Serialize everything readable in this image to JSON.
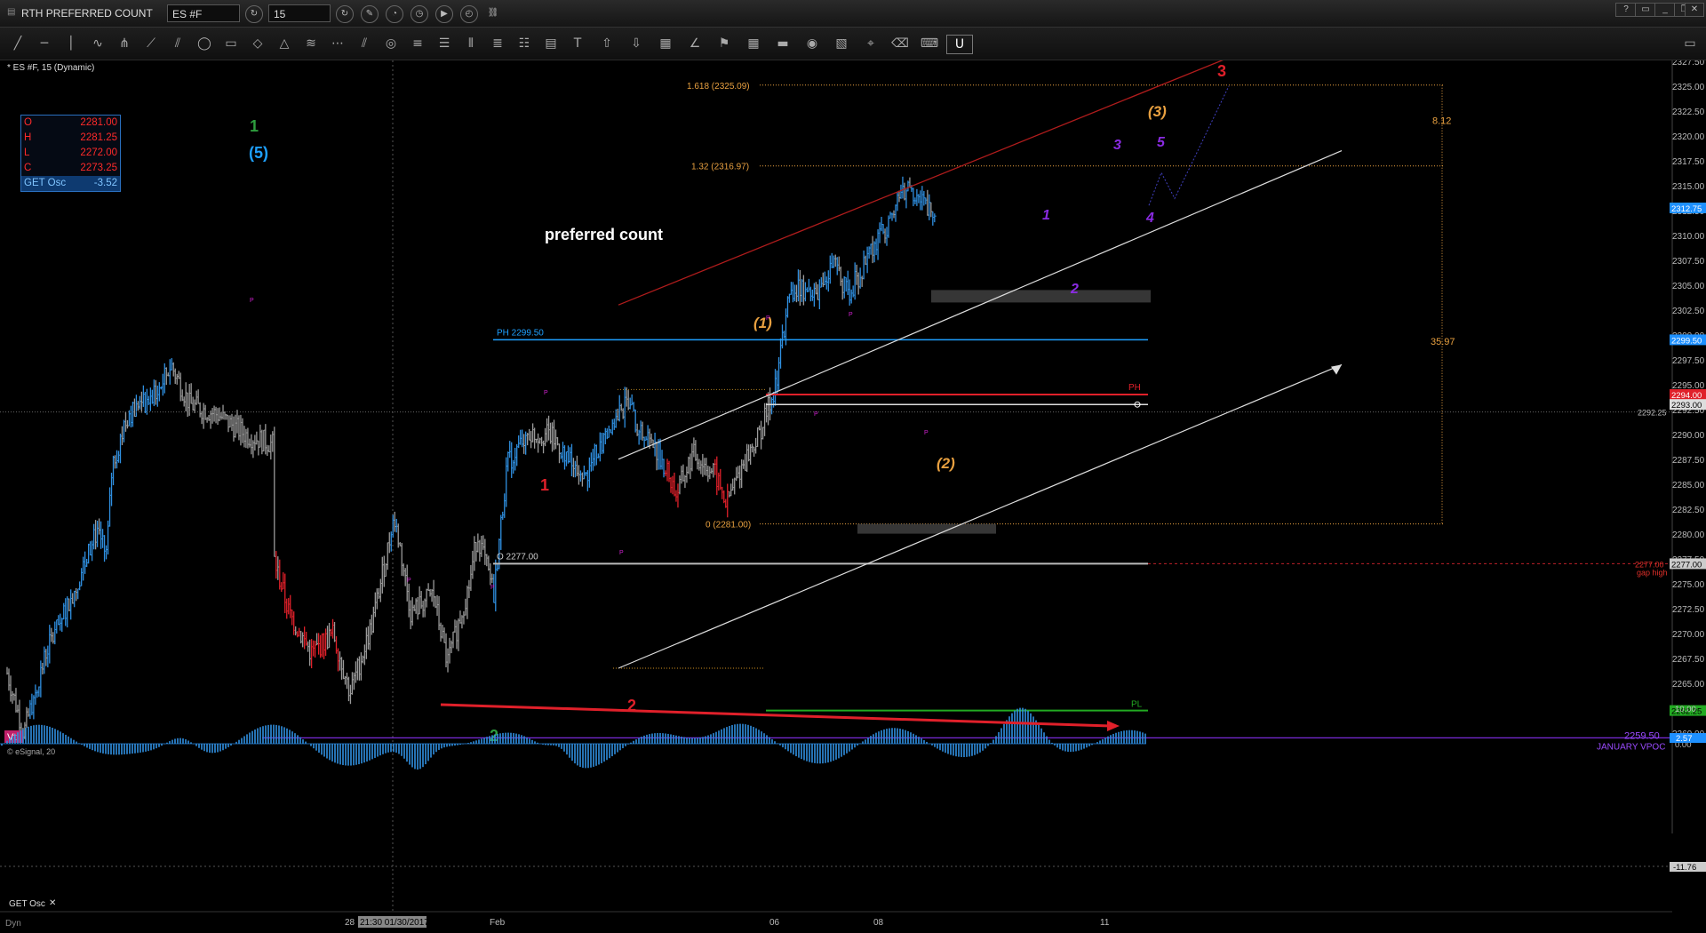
{
  "window": {
    "title": "RTH  PREFERRED COUNT",
    "symbol_value": "ES #F",
    "interval_value": "15"
  },
  "chart_header": "* ES #F, 15 (Dynamic)",
  "ohlc_box": [
    {
      "label": "O",
      "value": "2281.00"
    },
    {
      "label": "H",
      "value": "2281.25"
    },
    {
      "label": "L",
      "value": "2272.00"
    },
    {
      "label": "C",
      "value": "2273.25"
    },
    {
      "label": "GET Osc",
      "value": "-3.52"
    }
  ],
  "colors": {
    "up": "#2f8fe0",
    "down": "#e0202a",
    "neutral": "#9a9a9a",
    "fib": "#e8a040",
    "wave_purple": "#8a2be2"
  },
  "chart_data": {
    "type": "bar",
    "title": "preferred count",
    "subtitle": "* ES #F, 15 (Dynamic)",
    "ylim": [
      2257.5,
      2328.75
    ],
    "y_ticks": [
      "2327.50",
      "2325.00",
      "2322.50",
      "2320.00",
      "2317.50",
      "2315.00",
      "2312.50",
      "2310.00",
      "2307.50",
      "2305.00",
      "2302.50",
      "2300.00",
      "2297.50",
      "2295.00",
      "2292.50",
      "2290.00",
      "2287.50",
      "2285.00",
      "2282.50",
      "2280.00",
      "2277.50",
      "2275.00",
      "2272.50",
      "2270.00",
      "2267.50",
      "2265.00",
      "2262.50",
      "2260.00"
    ],
    "x_ticks": [
      "28",
      "21:30 01/30/2017",
      "Feb",
      "06",
      "08",
      "11"
    ],
    "price_path": [
      {
        "x": 0,
        "y": 2266
      },
      {
        "x": 15,
        "y": 2260
      },
      {
        "x": 35,
        "y": 2268
      },
      {
        "x": 60,
        "y": 2274
      },
      {
        "x": 80,
        "y": 2280
      },
      {
        "x": 90,
        "y": 2278
      },
      {
        "x": 95,
        "y": 2287
      },
      {
        "x": 110,
        "y": 2292
      },
      {
        "x": 135,
        "y": 2294
      },
      {
        "x": 148,
        "y": 2297
      },
      {
        "x": 165,
        "y": 2293
      },
      {
        "x": 190,
        "y": 2292
      },
      {
        "x": 215,
        "y": 2290
      },
      {
        "x": 240,
        "y": 2289
      },
      {
        "x": 240,
        "y": 2278
      },
      {
        "x": 255,
        "y": 2272
      },
      {
        "x": 275,
        "y": 2268
      },
      {
        "x": 295,
        "y": 2270
      },
      {
        "x": 310,
        "y": 2264
      },
      {
        "x": 330,
        "y": 2271
      },
      {
        "x": 345,
        "y": 2279
      },
      {
        "x": 350,
        "y": 2282
      },
      {
        "x": 365,
        "y": 2272
      },
      {
        "x": 385,
        "y": 2274
      },
      {
        "x": 398,
        "y": 2267
      },
      {
        "x": 418,
        "y": 2275
      },
      {
        "x": 425,
        "y": 2280
      },
      {
        "x": 440,
        "y": 2274
      },
      {
        "x": 452,
        "y": 2287
      },
      {
        "x": 470,
        "y": 2290
      },
      {
        "x": 490,
        "y": 2290
      },
      {
        "x": 505,
        "y": 2288
      },
      {
        "x": 520,
        "y": 2285
      },
      {
        "x": 540,
        "y": 2290
      },
      {
        "x": 560,
        "y": 2293
      },
      {
        "x": 575,
        "y": 2290
      },
      {
        "x": 590,
        "y": 2288
      },
      {
        "x": 605,
        "y": 2284
      },
      {
        "x": 620,
        "y": 2288
      },
      {
        "x": 640,
        "y": 2286
      },
      {
        "x": 650,
        "y": 2283
      },
      {
        "x": 665,
        "y": 2287
      },
      {
        "x": 680,
        "y": 2290
      },
      {
        "x": 695,
        "y": 2295
      },
      {
        "x": 705,
        "y": 2303
      },
      {
        "x": 715,
        "y": 2305
      },
      {
        "x": 730,
        "y": 2304
      },
      {
        "x": 748,
        "y": 2307
      },
      {
        "x": 760,
        "y": 2304
      },
      {
        "x": 780,
        "y": 2308
      },
      {
        "x": 800,
        "y": 2312
      },
      {
        "x": 815,
        "y": 2315
      },
      {
        "x": 830,
        "y": 2313
      },
      {
        "x": 840,
        "y": 2312
      }
    ],
    "oscillator": {
      "name": "GET Osc",
      "last": "2.57",
      "levels": [
        "10.00",
        "0.00",
        "-11.76"
      ]
    },
    "price_tags": [
      "2312.75",
      "2299.50",
      "2294.00",
      "2293.00",
      "2277.00",
      "2262.25",
      "2259.50",
      "2292.25",
      "2277.00"
    ],
    "levels": [
      {
        "label": "PH 2299.50",
        "price": 2299.5
      },
      {
        "label": "O 2277.00",
        "price": 2277.0
      },
      {
        "label": "PH",
        "price": 2294.0
      },
      {
        "label": "PL",
        "price": 2262.25
      },
      {
        "label": "2259.50",
        "price": 2259.5
      },
      {
        "label": "JANUARY VPOC",
        "price": 2259.5
      },
      {
        "label": "gap high",
        "price": 2277.0
      }
    ],
    "fib_labels": [
      "1.618 (2325.09)",
      "1.32 (2316.97)",
      "0 (2281.00)"
    ],
    "fib_distances": [
      "8.12",
      "35.97"
    ],
    "wave_labels": [
      {
        "label": "1",
        "color": "green"
      },
      {
        "label": "(5)",
        "color": "blue"
      },
      {
        "label": "1",
        "color": "red"
      },
      {
        "label": "2",
        "color": "red"
      },
      {
        "label": "2",
        "color": "green"
      },
      {
        "label": "(1)",
        "color": "orange"
      },
      {
        "label": "(2)",
        "color": "orange"
      },
      {
        "label": "(3)",
        "color": "orange"
      },
      {
        "label": "1",
        "color": "purple"
      },
      {
        "label": "2",
        "color": "purple"
      },
      {
        "label": "3",
        "color": "purple"
      },
      {
        "label": "4",
        "color": "purple"
      },
      {
        "label": "5",
        "color": "purple"
      },
      {
        "label": "3",
        "color": "red"
      }
    ],
    "vt_label": "Vt",
    "copyright": "© eSignal, 20",
    "dyn_label": "Dyn",
    "osc_label": "GET Osc"
  }
}
